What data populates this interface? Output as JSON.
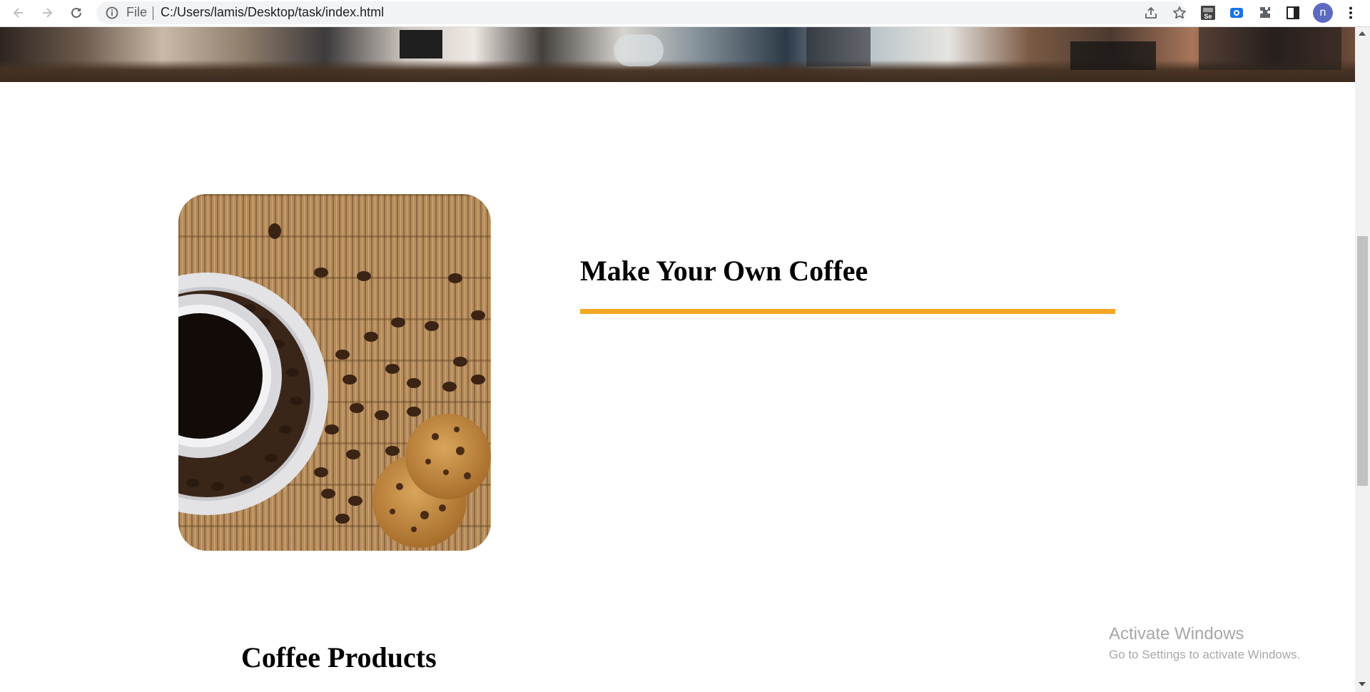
{
  "browser": {
    "address_prefix": "File",
    "url": "C:/Users/lamis/Desktop/task/index.html",
    "profile_initial": "n",
    "accent_color": "#5c6bc0"
  },
  "page": {
    "about": {
      "title": "Make Your Own Coffee",
      "underline_color": "#f5a623",
      "image_description_icon": "coffee-cup-beans-cookies-image"
    },
    "products": {
      "title": "Coffee Products"
    }
  },
  "os_watermark": {
    "title": "Activate Windows",
    "subtitle": "Go to Settings to activate Windows."
  }
}
